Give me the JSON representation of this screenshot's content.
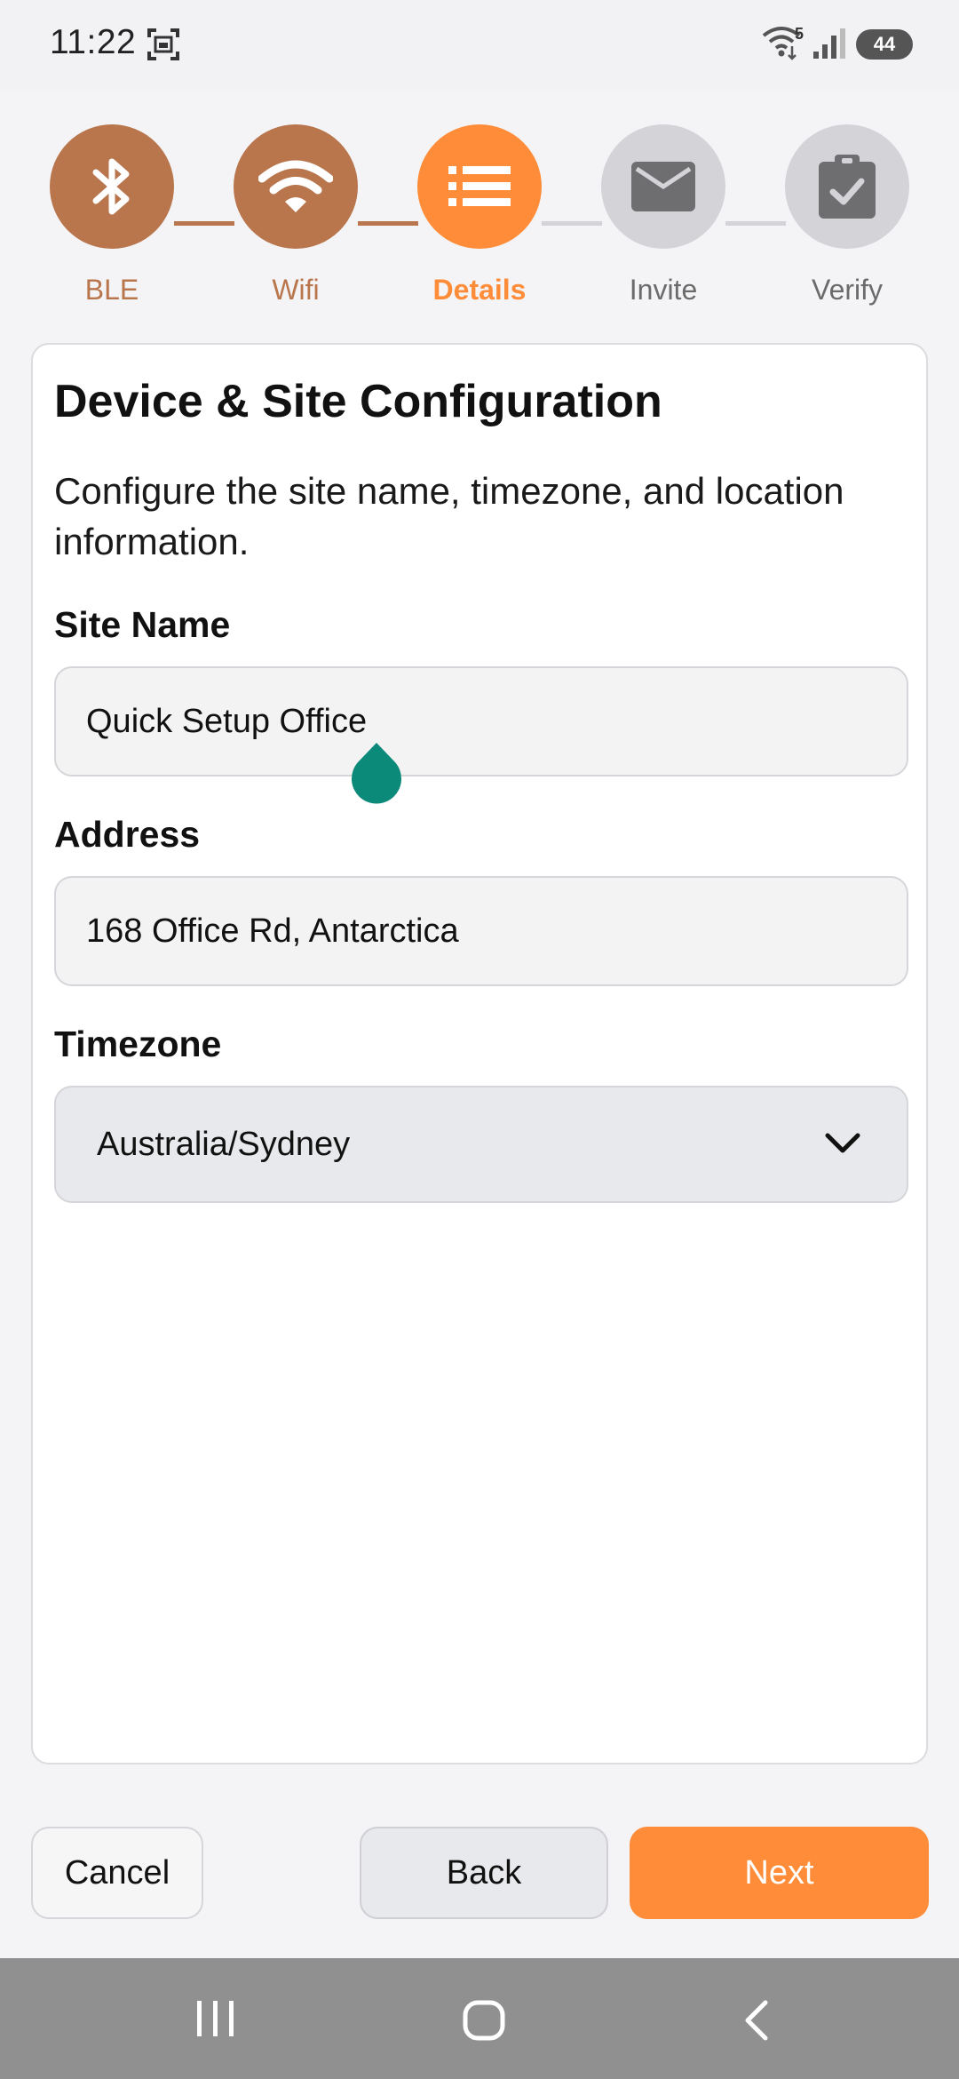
{
  "status_bar": {
    "time": "11:22",
    "wifi_sub": "5",
    "battery": "44",
    "icons": [
      "screenshot-icon",
      "wifi-icon",
      "signal-icon",
      "battery-icon"
    ]
  },
  "stepper": {
    "steps": [
      {
        "label": "BLE",
        "icon": "bluetooth-icon",
        "state": "completed"
      },
      {
        "label": "Wifi",
        "icon": "wifi-icon",
        "state": "completed"
      },
      {
        "label": "Details",
        "icon": "list-icon",
        "state": "active"
      },
      {
        "label": "Invite",
        "icon": "envelope-icon",
        "state": "pending"
      },
      {
        "label": "Verify",
        "icon": "clipboard-check-icon",
        "state": "pending"
      }
    ],
    "colors": {
      "completed": "#b9764d",
      "active": "#ff8c38",
      "pending": "#d4d4d8",
      "pending_icon": "#6e6e70",
      "pending_label": "#6b6b6b"
    }
  },
  "card": {
    "title": "Device & Site Configuration",
    "description": "Configure the site name, timezone, and location information.",
    "site_name": {
      "label": "Site Name",
      "value": "Quick Setup Office"
    },
    "address": {
      "label": "Address",
      "value": "168 Office Rd, Antarctica"
    },
    "timezone": {
      "label": "Timezone",
      "value": "Australia/Sydney"
    }
  },
  "buttons": {
    "cancel": "Cancel",
    "back": "Back",
    "next": "Next"
  },
  "colors": {
    "accent": "#ff8c38",
    "handle": "#0b8a79"
  }
}
